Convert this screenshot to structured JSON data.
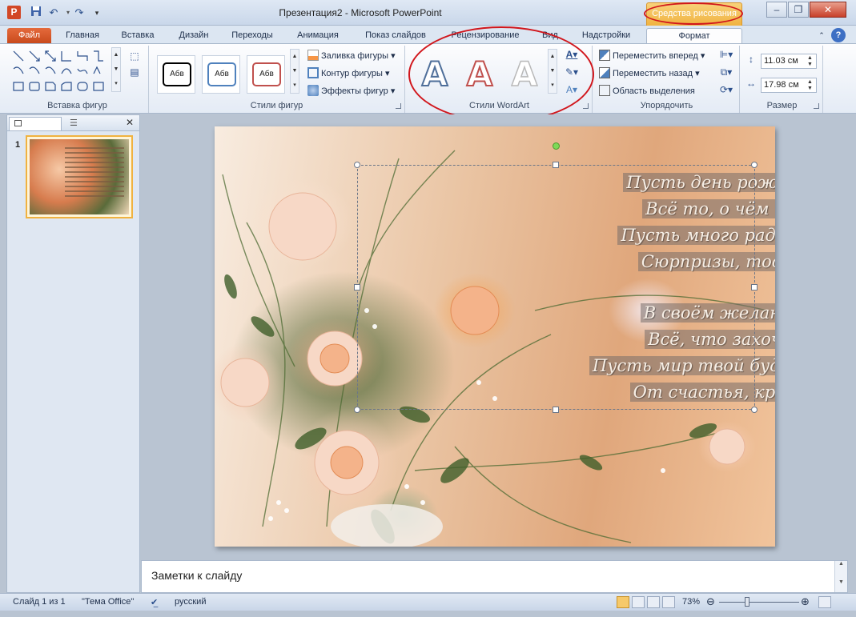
{
  "titlebar": {
    "app_icon": "P",
    "title": "Презентация2 - Microsoft PowerPoint",
    "contextual_tab": "Средства рисования",
    "qat": [
      "save-icon",
      "undo-icon",
      "redo-icon",
      "customize-icon"
    ]
  },
  "window_buttons": [
    "minimize",
    "maximize",
    "close"
  ],
  "tabs": [
    "Файл",
    "Главная",
    "Вставка",
    "Дизайн",
    "Переходы",
    "Анимация",
    "Показ слайдов",
    "Рецензирование",
    "Вид",
    "Надстройки",
    "Формат"
  ],
  "ribbon": {
    "groups": {
      "insert_shapes": "Вставка фигур",
      "shape_styles": "Стили фигур",
      "wordart_styles": "Стили WordArt",
      "arrange": "Упорядочить",
      "size": "Размер"
    },
    "shape_style_samples": [
      "Абв",
      "Абв",
      "Абв"
    ],
    "shape_fill": "Заливка фигуры",
    "shape_outline": "Контур фигуры",
    "shape_effects": "Эффекты фигур",
    "wordart_sample": "A",
    "bring_forward": "Переместить вперед",
    "send_backward": "Переместить назад",
    "selection_pane": "Область выделения",
    "height": "11.03 см",
    "width": "17.98 см"
  },
  "slides_pane": {
    "slide_number": "1"
  },
  "slide": {
    "poem": [
      "Пусть день рождения подарит",
      "Всё то, о чём твои мечты,",
      "Пусть много радости доставят",
      "Сюрпризы, тосты и цветы!",
      "В своём желании заветном",
      "Всё, что захочешь, назови,",
      "Пусть мир твой будет разноцветным",
      "От счастья, красоты, любви!"
    ]
  },
  "notes": "Заметки к слайду",
  "statusbar": {
    "slide": "Слайд 1 из 1",
    "theme": "\"Тема Office\"",
    "language": "русский",
    "zoom": "73%",
    "zoom_level": 0.73
  },
  "colors": {
    "accent": "#d24726",
    "file_tab": "#d9562a",
    "contextual": "#f0b240",
    "annotation": "#d1161c"
  }
}
